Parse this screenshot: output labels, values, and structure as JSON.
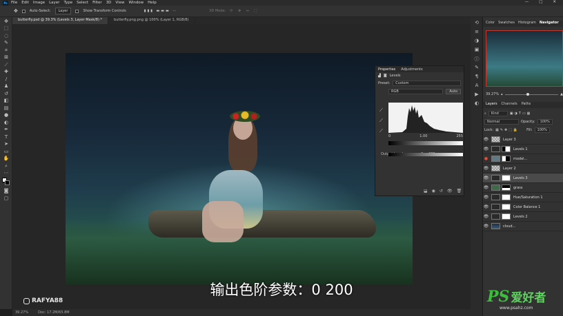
{
  "menubar": {
    "app_icon": "Ps",
    "items": [
      "File",
      "Edit",
      "Image",
      "Layer",
      "Type",
      "Select",
      "Filter",
      "3D",
      "View",
      "Window",
      "Help"
    ],
    "window_controls": [
      "—",
      "□",
      "✕"
    ]
  },
  "options_bar": {
    "auto_select_label": "Auto-Select:",
    "auto_select_value": "Layer",
    "show_transform_label": "Show Transform Controls",
    "mode_label": "3D Mode:"
  },
  "document_tabs": [
    {
      "label": "butterfly.psd @ 39.3% (Levels 3, Layer Mask/8) *",
      "active": true
    },
    {
      "label": "butterfly.png.png @ 100% (Layer 1, RGB/8)",
      "active": false
    }
  ],
  "toolbar_icons": [
    "move-icon",
    "marquee-icon",
    "lasso-icon",
    "quick-select-icon",
    "crop-icon",
    "frame-icon",
    "eyedropper-icon",
    "healing-icon",
    "brush-icon",
    "clone-stamp-icon",
    "history-brush-icon",
    "eraser-icon",
    "gradient-icon",
    "blur-icon",
    "dodge-icon",
    "pen-icon",
    "type-icon",
    "path-select-icon",
    "shape-icon",
    "hand-icon",
    "zoom-icon",
    "more-icon"
  ],
  "caption": "输出色阶参数：0 200",
  "instagram": {
    "handle": "RAFYA88"
  },
  "statusbar": {
    "zoom": "39.27%",
    "doc": "Doc: 17.2M/65.8M"
  },
  "properties_panel": {
    "tabs": [
      "Properties",
      "Adjustments"
    ],
    "title": "Levels",
    "preset_label": "Preset:",
    "preset_value": "Custom",
    "channel_value": "RGB",
    "auto_label": "Auto",
    "input_levels": {
      "black": "0",
      "gamma": "1.00",
      "white": "255"
    },
    "output_label": "Output Levels:",
    "output_levels": {
      "black": "0",
      "white": "200"
    }
  },
  "panel_tabs_top": [
    "Color",
    "Swatches",
    "Histogram",
    "Navigator"
  ],
  "navigator": {
    "zoom": "39.27%"
  },
  "layers_tabs": [
    "Layers",
    "Channels",
    "Paths"
  ],
  "layers_controls": {
    "kind_label": "Kind",
    "blend_mode": "Normal",
    "opacity_label": "Opacity:",
    "opacity_value": "100%",
    "lock_label": "Lock:",
    "fill_label": "Fill:",
    "fill_value": "100%"
  },
  "layers": [
    {
      "name": "Layer 3",
      "selected": false
    },
    {
      "name": "Levels 1",
      "selected": false
    },
    {
      "name": "model...",
      "selected": false
    },
    {
      "name": "Layer 2",
      "selected": false
    },
    {
      "name": "Levels 3",
      "selected": true
    },
    {
      "name": "grass",
      "selected": false
    },
    {
      "name": "Hue/Saturation 1",
      "selected": false
    },
    {
      "name": "Color Balance 1",
      "selected": false
    },
    {
      "name": "Levels 2",
      "selected": false
    },
    {
      "name": "cloud...",
      "selected": false
    }
  ],
  "watermark": {
    "brand": "PS",
    "cn": "爱好者",
    "url": "www.psahz.com"
  },
  "colors": {
    "selected_layer": "#4a4a4a",
    "navigator_frame": "#c0392b",
    "watermark": "#3bbf3b"
  }
}
